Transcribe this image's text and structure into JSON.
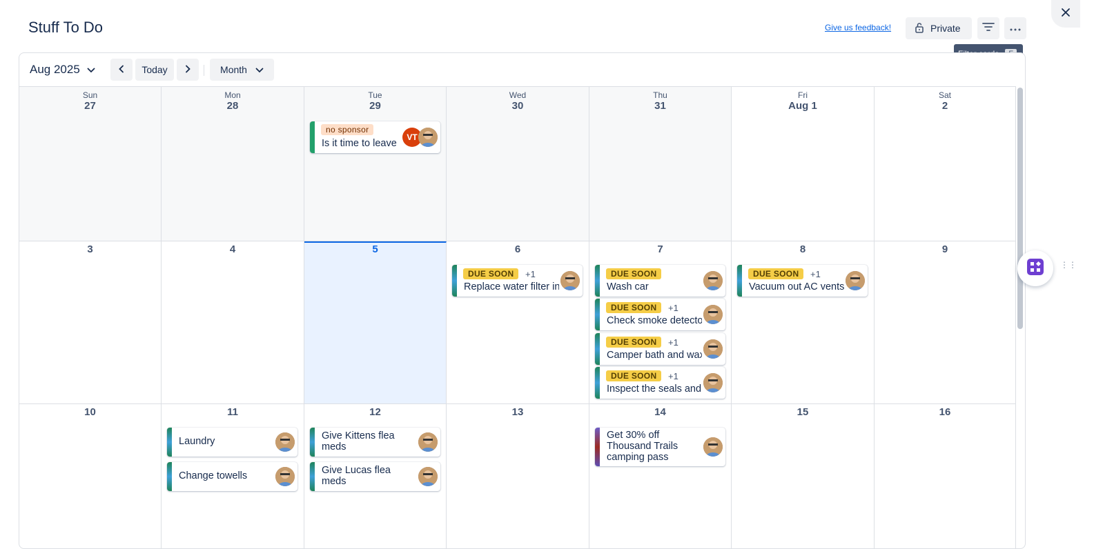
{
  "header": {
    "title": "Stuff To Do",
    "feedback_link": "Give us feedback!",
    "private_label": "Private",
    "tooltip": "Filter cards",
    "tooltip_key": "F"
  },
  "toolbar": {
    "month_label": "Aug 2025",
    "today_label": "Today",
    "view_label": "Month"
  },
  "calendar": {
    "days_of_week": [
      "Sun",
      "Mon",
      "Tue",
      "Wed",
      "Thu",
      "Fri",
      "Sat"
    ],
    "week1": [
      "27",
      "28",
      "29",
      "30",
      "31",
      "Aug 1",
      "2"
    ],
    "week2": [
      "3",
      "4",
      "5",
      "6",
      "7",
      "8",
      "9"
    ],
    "week3": [
      "10",
      "11",
      "12",
      "13",
      "14",
      "15",
      "16"
    ],
    "cards": [
      {
        "label": "no sponsor",
        "title": "Is it time to leave",
        "extra": "",
        "initials": "VT"
      },
      {
        "label": "DUE SOON",
        "title": "Replace water filter in",
        "extra": "+1"
      },
      {
        "label": "DUE SOON",
        "title": "Wash car",
        "extra": ""
      },
      {
        "label": "DUE SOON",
        "title": "Vacuum out AC vents",
        "extra": "+1"
      },
      {
        "label": "DUE SOON",
        "title": "Check smoke detecto",
        "extra": "+1"
      },
      {
        "label": "DUE SOON",
        "title": "Camper bath and wax",
        "extra": "+1"
      },
      {
        "label": "DUE SOON",
        "title": "Inspect the seals and",
        "extra": "+1"
      },
      {
        "label": "",
        "title": "Laundry",
        "extra": ""
      },
      {
        "label": "",
        "title": "Change towells",
        "extra": ""
      },
      {
        "label": "",
        "title": "Give Kittens flea meds",
        "extra": ""
      },
      {
        "label": "",
        "title": "Give Lucas flea meds",
        "extra": ""
      },
      {
        "label": "",
        "title": "Get 30% off Thousand Trails camping pass",
        "extra": ""
      }
    ]
  },
  "colors": {
    "accent": "#0c66e4",
    "due_soon": "#f5cd47",
    "sponsor": "#fedec8",
    "today_bg": "#e9f2ff"
  }
}
